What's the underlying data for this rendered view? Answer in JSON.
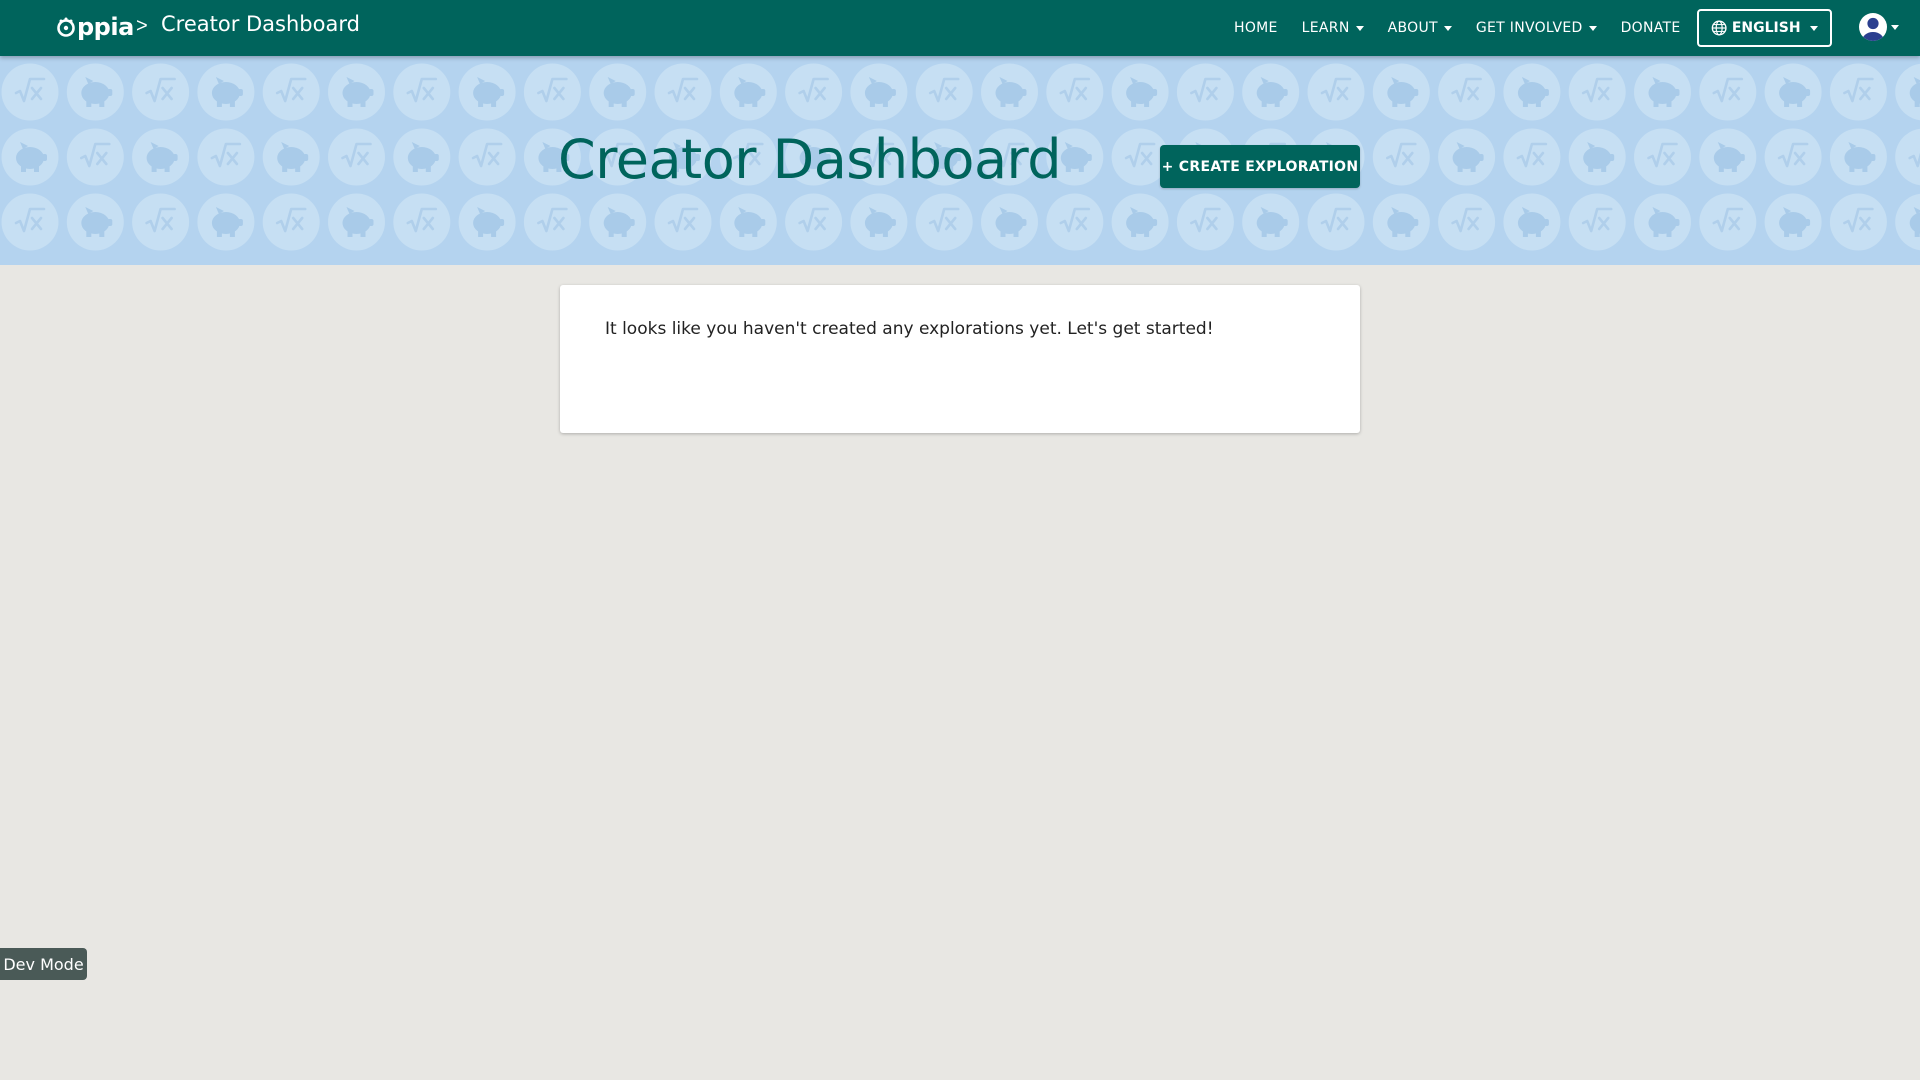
{
  "header": {
    "logo_text": "ppia",
    "breadcrumb_separator": ">",
    "breadcrumb_title": "Creator Dashboard",
    "nav": {
      "home": "HOME",
      "learn": "LEARN",
      "about": "ABOUT",
      "get_involved": "GET INVOLVED",
      "donate": "DONATE"
    },
    "language": "ENGLISH",
    "icons": {
      "logo": "oppia-logo-icon",
      "globe": "globe-icon",
      "avatar": "user-avatar-icon",
      "caret": "chevron-down-icon"
    }
  },
  "banner": {
    "title": "Creator Dashboard",
    "create_button_label": "+ CREATE EXPLORATION",
    "pattern_icons": [
      "square-root-icon",
      "piggy-bank-icon"
    ]
  },
  "main": {
    "empty_message": "It looks like you haven't created any explorations yet. Let's get started!"
  },
  "dev_badge": "Dev Mode",
  "colors": {
    "primary": "#00645c",
    "banner_bg": "#b4d3ef",
    "page_bg": "#e8e7e3",
    "badge_bg": "#4a5a57"
  }
}
